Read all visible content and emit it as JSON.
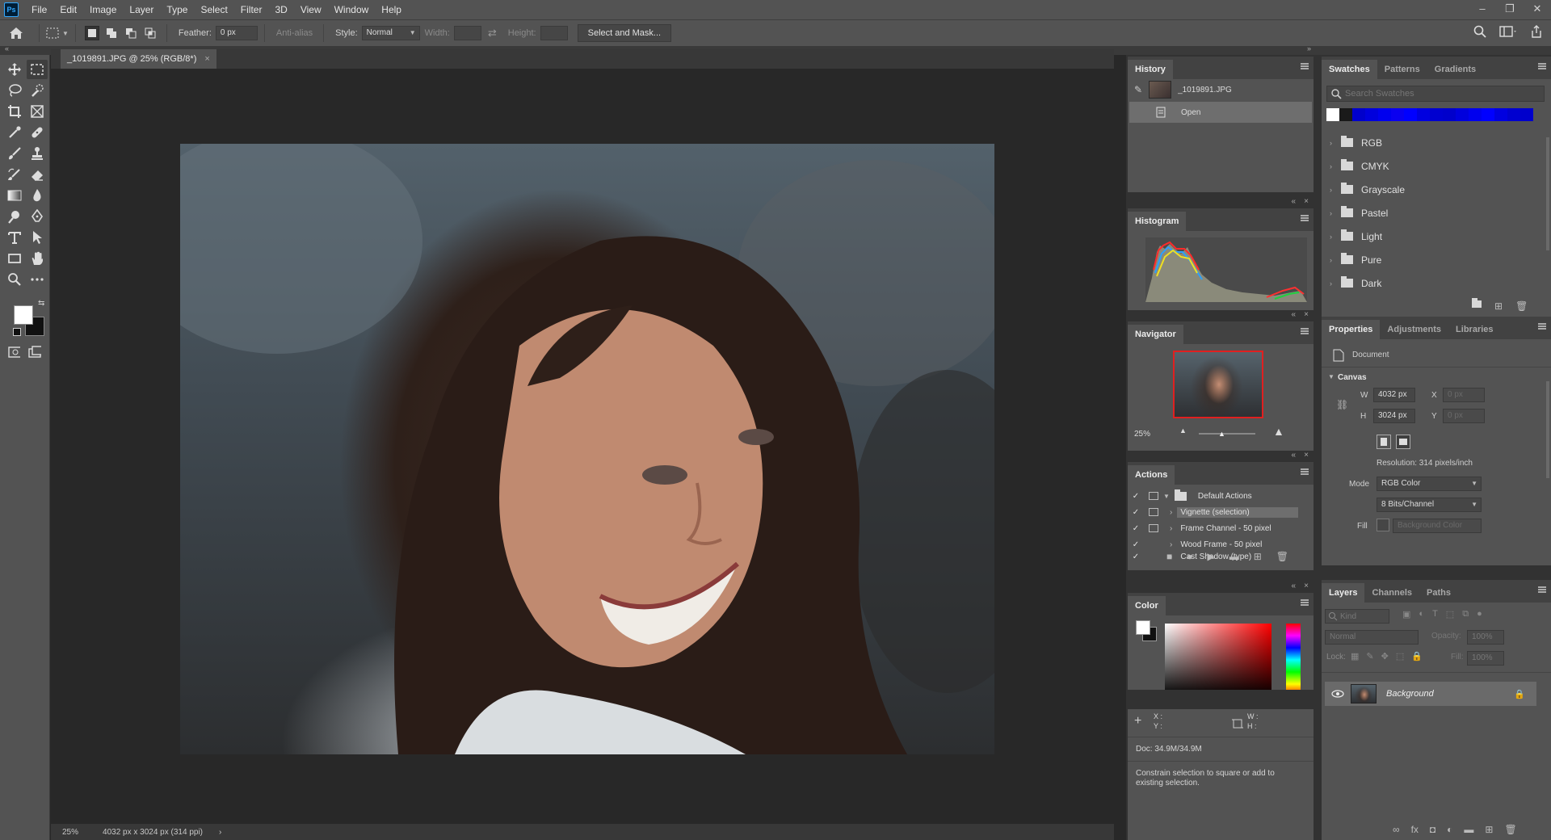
{
  "app": {
    "logo": "Ps"
  },
  "menu": [
    "File",
    "Edit",
    "Image",
    "Layer",
    "Type",
    "Select",
    "Filter",
    "3D",
    "View",
    "Window",
    "Help"
  ],
  "window_controls": {
    "minimize": "–",
    "restore": "❐",
    "close": "✕"
  },
  "options": {
    "feather_label": "Feather:",
    "feather_value": "0 px",
    "antialias_label": "Anti-alias",
    "style_label": "Style:",
    "style_value": "Normal",
    "width_label": "Width:",
    "height_label": "Height:",
    "select_mask_label": "Select and Mask..."
  },
  "document": {
    "tab_title": "_1019891.JPG @ 25% (RGB/8*)",
    "tab_close": "×",
    "status_zoom": "25%",
    "status_info": "4032 px x 3024 px (314 ppi)",
    "status_arrow": "›"
  },
  "history": {
    "tab": "History",
    "snapshot_name": "_1019891.JPG",
    "step": "Open"
  },
  "histogram": {
    "tab": "Histogram"
  },
  "navigator": {
    "tab": "Navigator",
    "zoom": "25%"
  },
  "actions": {
    "tab": "Actions",
    "set_name": "Default Actions",
    "items": [
      "Vignette (selection)",
      "Frame Channel - 50 pixel",
      "Wood Frame - 50 pixel",
      "Cast Shadow (type)"
    ]
  },
  "color": {
    "tab": "Color"
  },
  "info": {
    "x_label": "X :",
    "y_label": "Y :",
    "w_label": "W :",
    "h_label": "H :",
    "doc_size": "Doc: 34.9M/34.9M",
    "hint": "Constrain selection to square or add to existing selection."
  },
  "swatches": {
    "tabs": [
      "Swatches",
      "Patterns",
      "Gradients"
    ],
    "search_placeholder": "Search Swatches",
    "groups": [
      "RGB",
      "CMYK",
      "Grayscale",
      "Pastel",
      "Light",
      "Pure",
      "Dark"
    ],
    "recent_colors": [
      "#ffffff",
      "#1a1a1a",
      "#0000cc",
      "#0000dd",
      "#0000ee",
      "#0a00f0",
      "#0000ff",
      "#0000e0",
      "#0000d0",
      "#0000cc",
      "#0000dd",
      "#0000ee",
      "#0000ff",
      "#0000e0",
      "#0000d0",
      "#0000cc"
    ]
  },
  "properties": {
    "tabs": [
      "Properties",
      "Adjustments",
      "Libraries"
    ],
    "type": "Document",
    "section": "Canvas",
    "w_label": "W",
    "w_value": "4032 px",
    "h_label": "H",
    "h_value": "3024 px",
    "x_label": "X",
    "x_value": "0 px",
    "y_label": "Y",
    "y_value": "0 px",
    "resolution": "Resolution: 314 pixels/inch",
    "mode_label": "Mode",
    "mode_value": "RGB Color",
    "depth_value": "8 Bits/Channel",
    "fill_label": "Fill",
    "fill_value": "Background Color"
  },
  "layers": {
    "tabs": [
      "Layers",
      "Channels",
      "Paths"
    ],
    "kind_placeholder": "Kind",
    "blend_mode": "Normal",
    "opacity_label": "Opacity:",
    "opacity_value": "100%",
    "lock_label": "Lock:",
    "fill_label": "Fill:",
    "fill_value": "100%",
    "layer_name": "Background"
  },
  "colors": {
    "accent_selection": "#6e6e6e",
    "navigator_frame": "#e02020"
  }
}
